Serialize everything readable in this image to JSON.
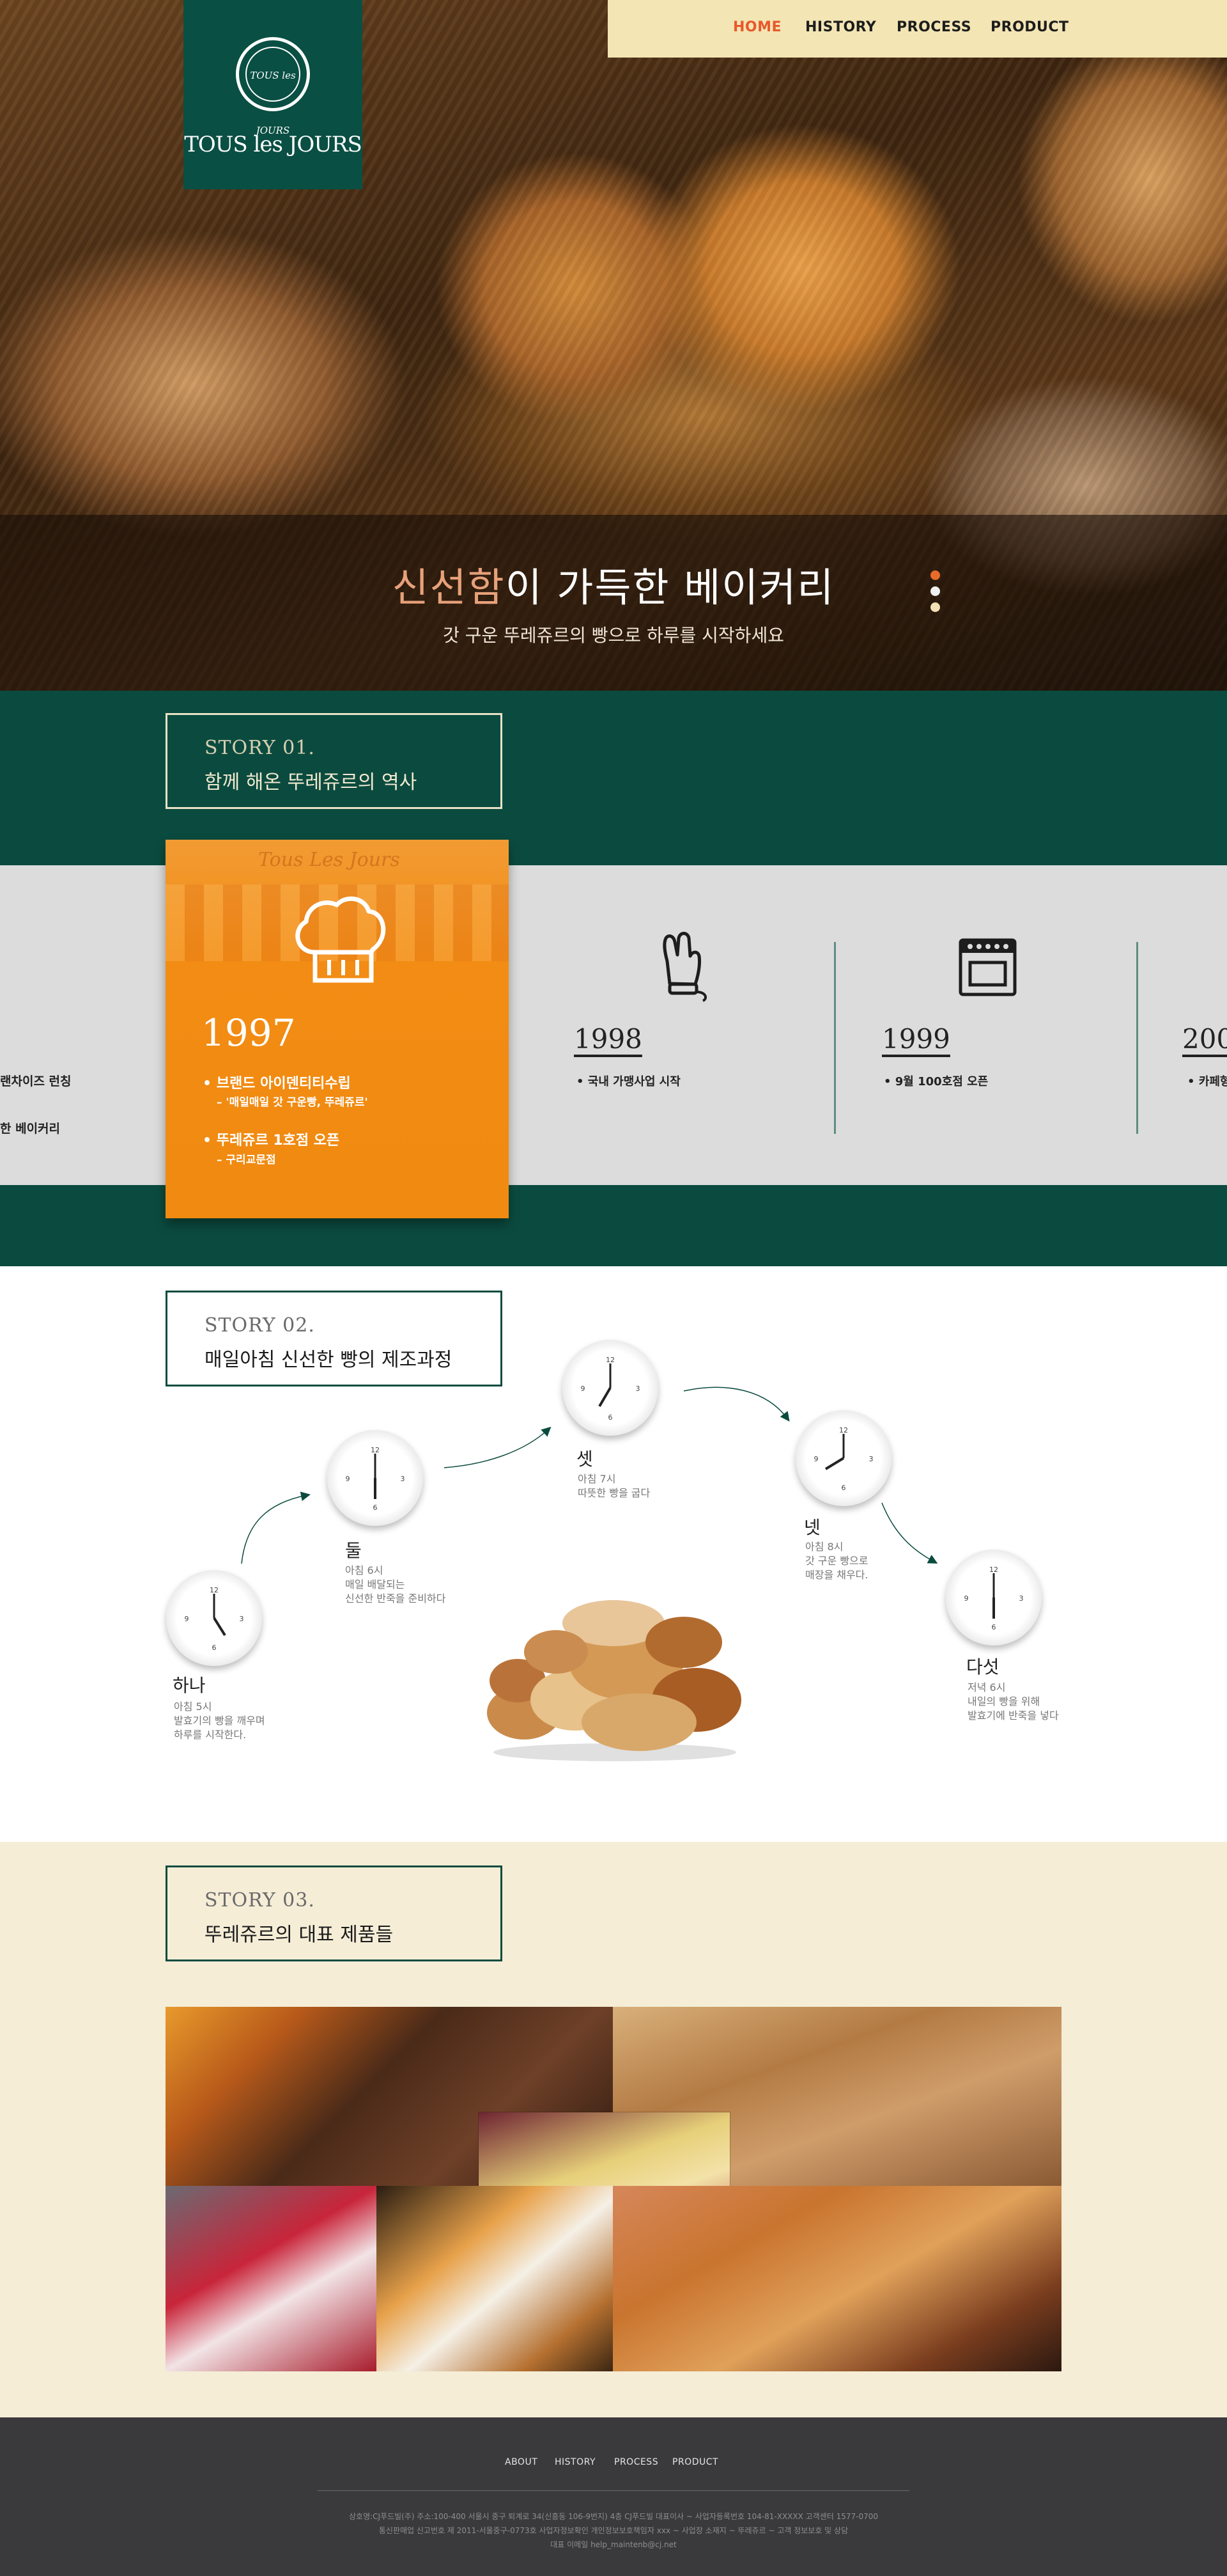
{
  "nav": {
    "items": [
      "HOME",
      "HISTORY",
      "PROCESS",
      "PRODUCT"
    ],
    "active": "HOME"
  },
  "logo": {
    "brand": "TOUS les JOURS",
    "emblem": "TOUS les JOURS"
  },
  "hero": {
    "title_accent": "신선함",
    "title_rest": "이 가득한 베이커리",
    "subtitle": "갓 구운 뚜레쥬르의 빵으로 하루를 시작하세요",
    "slide_dots": 3,
    "active_dot": 1
  },
  "story1": {
    "label": "STORY 01.",
    "title": "함께 해온 뚜레쥬르의 역사",
    "edge_left": [
      "랜차이즈 런칭",
      "한 베이커리"
    ],
    "featured": {
      "sign": "Tous Les Jours",
      "year": "1997",
      "lines": [
        {
          "main": "• 브랜드 아이덴티티수립",
          "sub": "– '매일매일 갓 구운빵, 뚜레쥬르'"
        },
        {
          "main": "• 뚜레쥬르 1호점 오픈",
          "sub": "– 구리교문점"
        }
      ]
    },
    "timeline": [
      {
        "year": "1998",
        "desc": "• 국내 가맹사업 시작",
        "icon": "oven-mitt-icon"
      },
      {
        "year": "1999",
        "desc": "• 9월 100호점 오픈",
        "icon": "oven-icon"
      },
      {
        "year": "200",
        "desc": "• 카페형",
        "icon": ""
      }
    ]
  },
  "story2": {
    "label": "STORY 02.",
    "title": "매일아침  신선한 빵의 제조과정",
    "steps": [
      {
        "name": "하나",
        "desc": [
          "아침 5시",
          "발효기의 빵을 깨우며",
          "하루를 시작한다."
        ],
        "time": "5:00"
      },
      {
        "name": "둘",
        "desc": [
          "아침 6시",
          "매일 배달되는",
          "신선한 반죽을 준비하다"
        ],
        "time": "6:00"
      },
      {
        "name": "셋",
        "desc": [
          "아침 7시",
          "따뜻한 빵을 굽다"
        ],
        "time": "7:00"
      },
      {
        "name": "넷",
        "desc": [
          "아침 8시",
          "갓 구운 빵으로",
          "매장을 채우다."
        ],
        "time": "8:00"
      },
      {
        "name": "다섯",
        "desc": [
          "저녁 6시",
          "내일의 빵을 위해",
          "발효기에 반죽을 넣다"
        ],
        "time": "6:00"
      }
    ]
  },
  "story3": {
    "label": "STORY 03.",
    "title": "뚜레쥬르의 대표 제품들"
  },
  "footer": {
    "nav": [
      "ABOUT",
      "HISTORY",
      "PROCESS",
      "PRODUCT"
    ],
    "info_lines": [
      "상호명:CJ푸드빌(주)  주소:100-400 서울시 중구 퇴계로 34(신흥동 106-9번지) 4층 CJ푸드빌 대표이사 ~ 사업자등록번호 104-81-XXXXX  고객센터 1577-0700",
      "통신판매업 신고번호 제 2011-서울중구-0773호  사업자정보확인  개인정보보호책임자 xxx  ~ 사업장 소재지 ~ 뚜레쥬르 ~ 고객 정보보호 및 상담",
      "대표 이메일 help_maintenb@cj.net"
    ]
  },
  "colors": {
    "brand_green": "#0b4b3f",
    "accent_orange": "#f08a10",
    "nav_bg": "#f3e5b4",
    "nav_active": "#e8592b",
    "cream": "#f5edd6"
  }
}
